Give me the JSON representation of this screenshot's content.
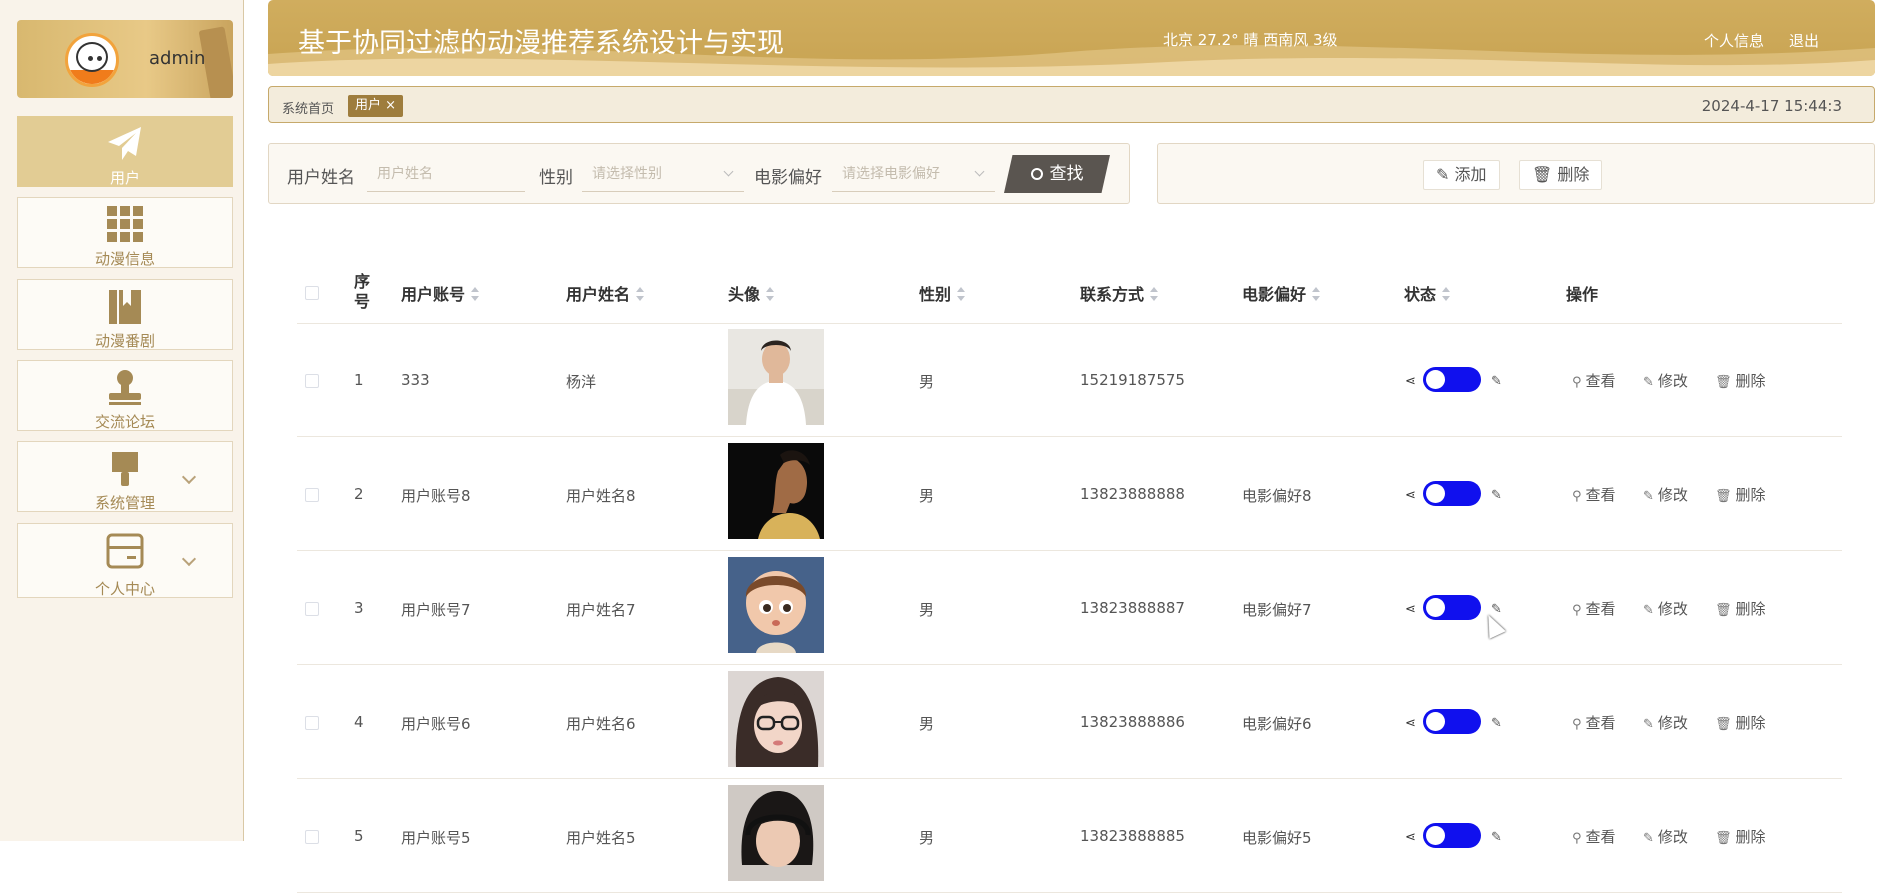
{
  "sidebar": {
    "user_name": "admin",
    "items": [
      {
        "label": "用户",
        "icon": "paper-plane-icon",
        "active": true
      },
      {
        "label": "动漫信息",
        "icon": "grid-icon"
      },
      {
        "label": "动漫番剧",
        "icon": "book-icon"
      },
      {
        "label": "交流论坛",
        "icon": "stamp-icon"
      },
      {
        "label": "系统管理",
        "icon": "brush-icon",
        "expandable": true
      },
      {
        "label": "个人中心",
        "icon": "card-icon",
        "expandable": true
      }
    ]
  },
  "header": {
    "title": "基于协同过滤的动漫推荐系统设计与实现",
    "weather": "北京  27.2°  晴  西南风  3级",
    "profile_link": "个人信息",
    "logout_link": "退出"
  },
  "breadcrumb": {
    "home": "系统首页",
    "tag": "用户 ×",
    "datetime": "2024-4-17 15:44:3"
  },
  "search": {
    "name_label": "用户姓名",
    "name_placeholder": "用户姓名",
    "gender_label": "性别",
    "gender_placeholder": "请选择性别",
    "pref_label": "电影偏好",
    "pref_placeholder": "请选择电影偏好",
    "find_label": "查找"
  },
  "actions": {
    "add_label": "添加",
    "delete_label": "删除"
  },
  "table": {
    "columns": [
      "序号",
      "用户账号",
      "用户姓名",
      "头像",
      "性别",
      "联系方式",
      "电影偏好",
      "状态",
      "操作"
    ],
    "rows": [
      {
        "index": "1",
        "account": "333",
        "name": "杨洋",
        "gender": "男",
        "phone": "15219187575",
        "preference": ""
      },
      {
        "index": "2",
        "account": "用户账号8",
        "name": "用户姓名8",
        "gender": "男",
        "phone": "13823888888",
        "preference": "电影偏好8"
      },
      {
        "index": "3",
        "account": "用户账号7",
        "name": "用户姓名7",
        "gender": "男",
        "phone": "13823888887",
        "preference": "电影偏好7"
      },
      {
        "index": "4",
        "account": "用户账号6",
        "name": "用户姓名6",
        "gender": "男",
        "phone": "13823888886",
        "preference": "电影偏好6"
      },
      {
        "index": "5",
        "account": "用户账号5",
        "name": "用户姓名5",
        "gender": "男",
        "phone": "13823888885",
        "preference": "电影偏好5"
      }
    ],
    "ops": {
      "view": "查看",
      "edit": "修改",
      "delete": "删除"
    }
  },
  "colors": {
    "accent": "#c8a352",
    "switch_on": "#1010ee",
    "nav_active": "#e2cc94"
  }
}
